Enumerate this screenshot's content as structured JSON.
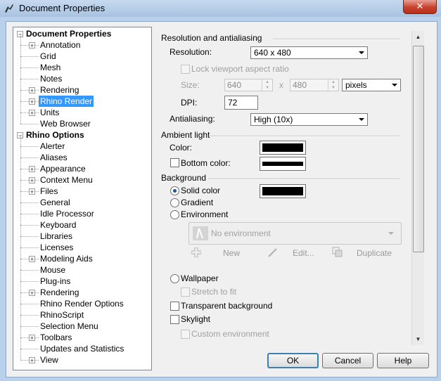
{
  "window": {
    "title": "Document Properties",
    "close_glyph": "✕"
  },
  "tree": {
    "document_properties": "Document Properties",
    "doc_items": [
      "Annotation",
      "Grid",
      "Mesh",
      "Notes",
      "Rendering",
      "Rhino Render",
      "Units",
      "Web Browser"
    ],
    "rhino_options": "Rhino Options",
    "rhino_items": [
      "Alerter",
      "Aliases",
      "Appearance",
      "Context Menu",
      "Files",
      "General",
      "Idle Processor",
      "Keyboard",
      "Libraries",
      "Licenses",
      "Modeling Aids",
      "Mouse",
      "Plug-ins",
      "Rendering",
      "Rhino Render Options",
      "RhinoScript",
      "Selection Menu",
      "Toolbars",
      "Updates and Statistics",
      "View"
    ],
    "selected": "Rhino Render"
  },
  "resolution": {
    "section": "Resolution and antialiasing",
    "resolution_label": "Resolution:",
    "resolution_value": "640 x 480",
    "lock_label": "Lock viewport aspect ratio",
    "size_label": "Size:",
    "width": "640",
    "x_sep": "x",
    "height": "480",
    "units": "pixels",
    "dpi_label": "DPI:",
    "dpi": "72",
    "antialiasing_label": "Antialiasing:",
    "antialiasing_value": "High (10x)"
  },
  "ambient": {
    "section": "Ambient light",
    "color_label": "Color:",
    "bottom_color_label": "Bottom color:",
    "color_hex": "#000000"
  },
  "background": {
    "section": "Background",
    "solid": "Solid color",
    "gradient": "Gradient",
    "environment": "Environment",
    "environment_value": "No environment",
    "tool_new": "New",
    "tool_edit": "Edit...",
    "tool_duplicate": "Duplicate",
    "wallpaper": "Wallpaper",
    "stretch": "Stretch to fit",
    "transparent": "Transparent background",
    "skylight": "Skylight",
    "custom_env": "Custom environment"
  },
  "buttons": {
    "ok": "OK",
    "cancel": "Cancel",
    "help": "Help"
  },
  "colors": {
    "selection": "#3399ff",
    "default_button_border": "#3c7fb1",
    "titlebar": "#b9d1ea"
  }
}
